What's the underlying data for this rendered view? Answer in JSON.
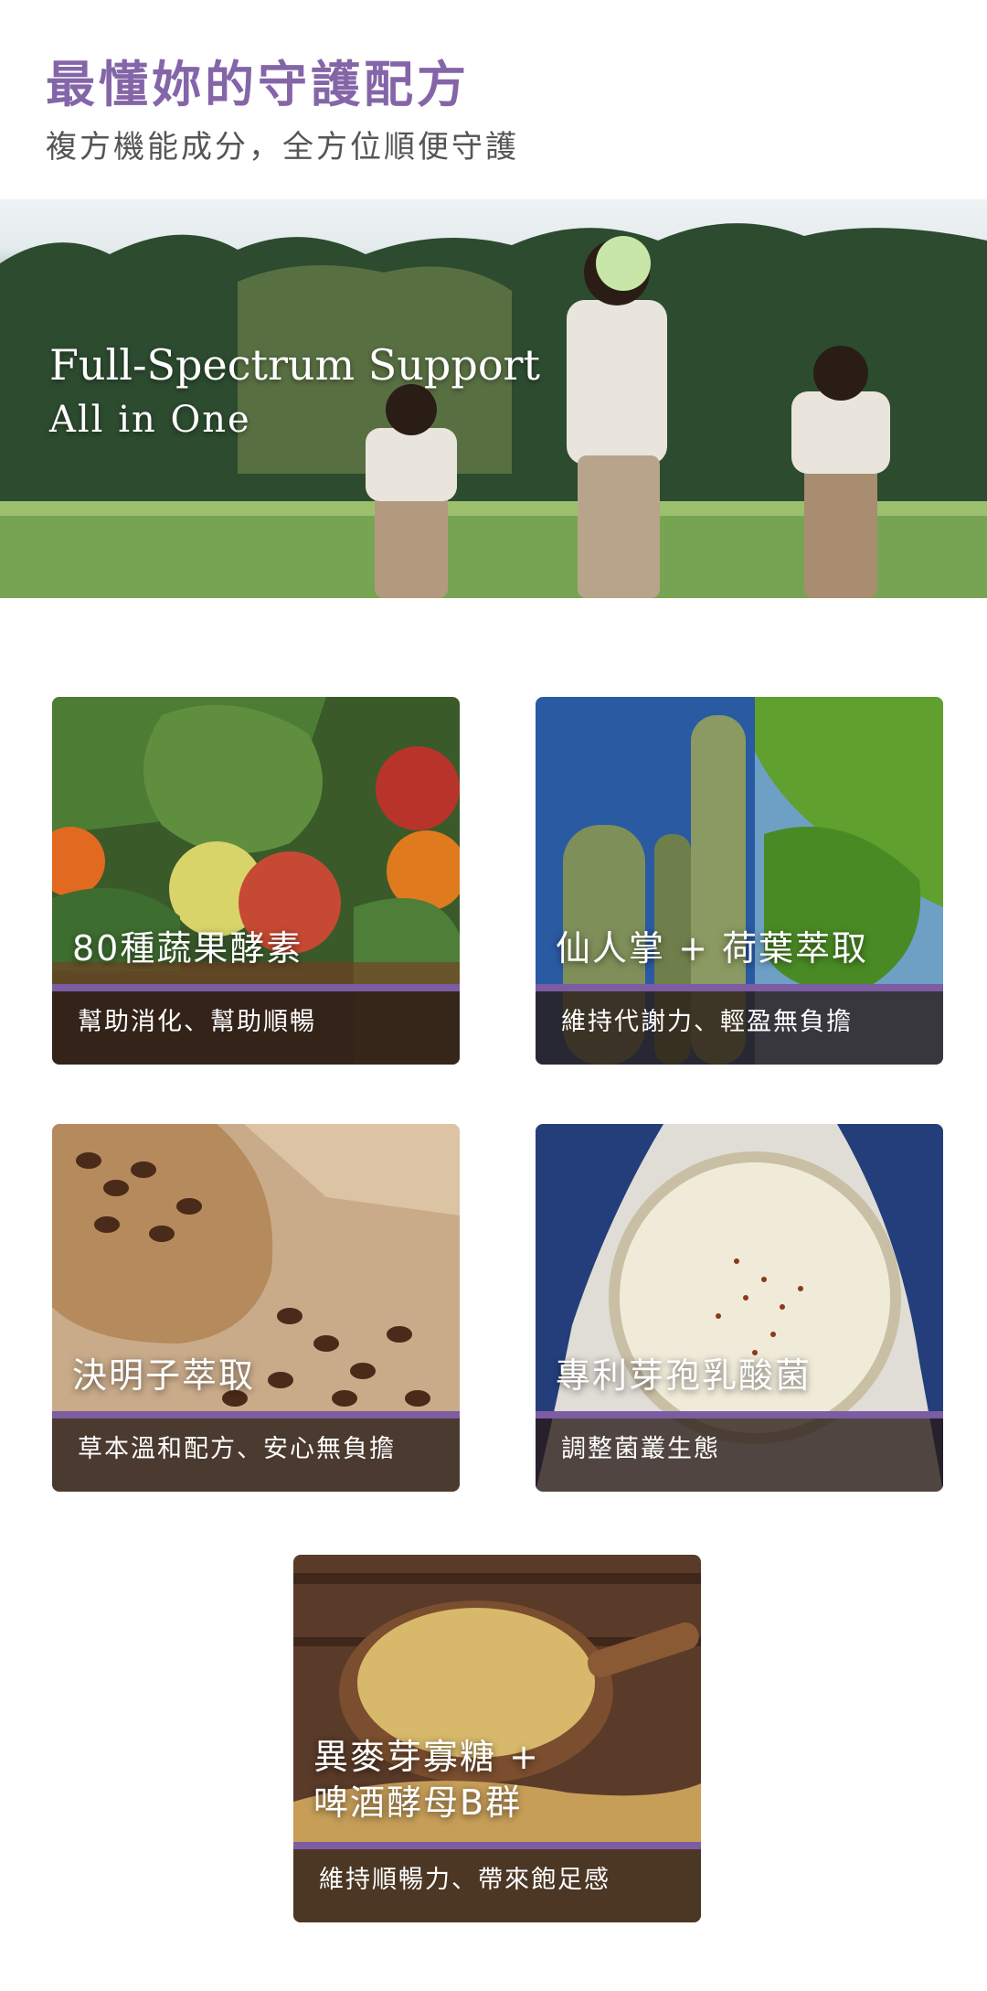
{
  "header": {
    "title": "最懂妳的守護配方",
    "subtitle": "複方機能成分，全方位順便守護"
  },
  "hero": {
    "line1": "Full-Spectrum Support",
    "line2": "All in One"
  },
  "cards": [
    {
      "title": "80種蔬果酵素",
      "desc": "幫助消化、幫助順暢"
    },
    {
      "title": "仙人掌 + 荷葉萃取",
      "desc": "維持代謝力、輕盈無負擔"
    },
    {
      "title": "決明子萃取",
      "desc": "草本溫和配方、安心無負擔"
    },
    {
      "title": "專利芽孢乳酸菌",
      "desc": "調整菌叢生態"
    },
    {
      "title_line1": "異麥芽寡糖 +",
      "title_line2": "啤酒酵母B群",
      "desc": "維持順暢力、帶來飽足感"
    }
  ],
  "colors": {
    "title_purple": "#8466a8",
    "bar_purple": "#7c5ca2"
  }
}
